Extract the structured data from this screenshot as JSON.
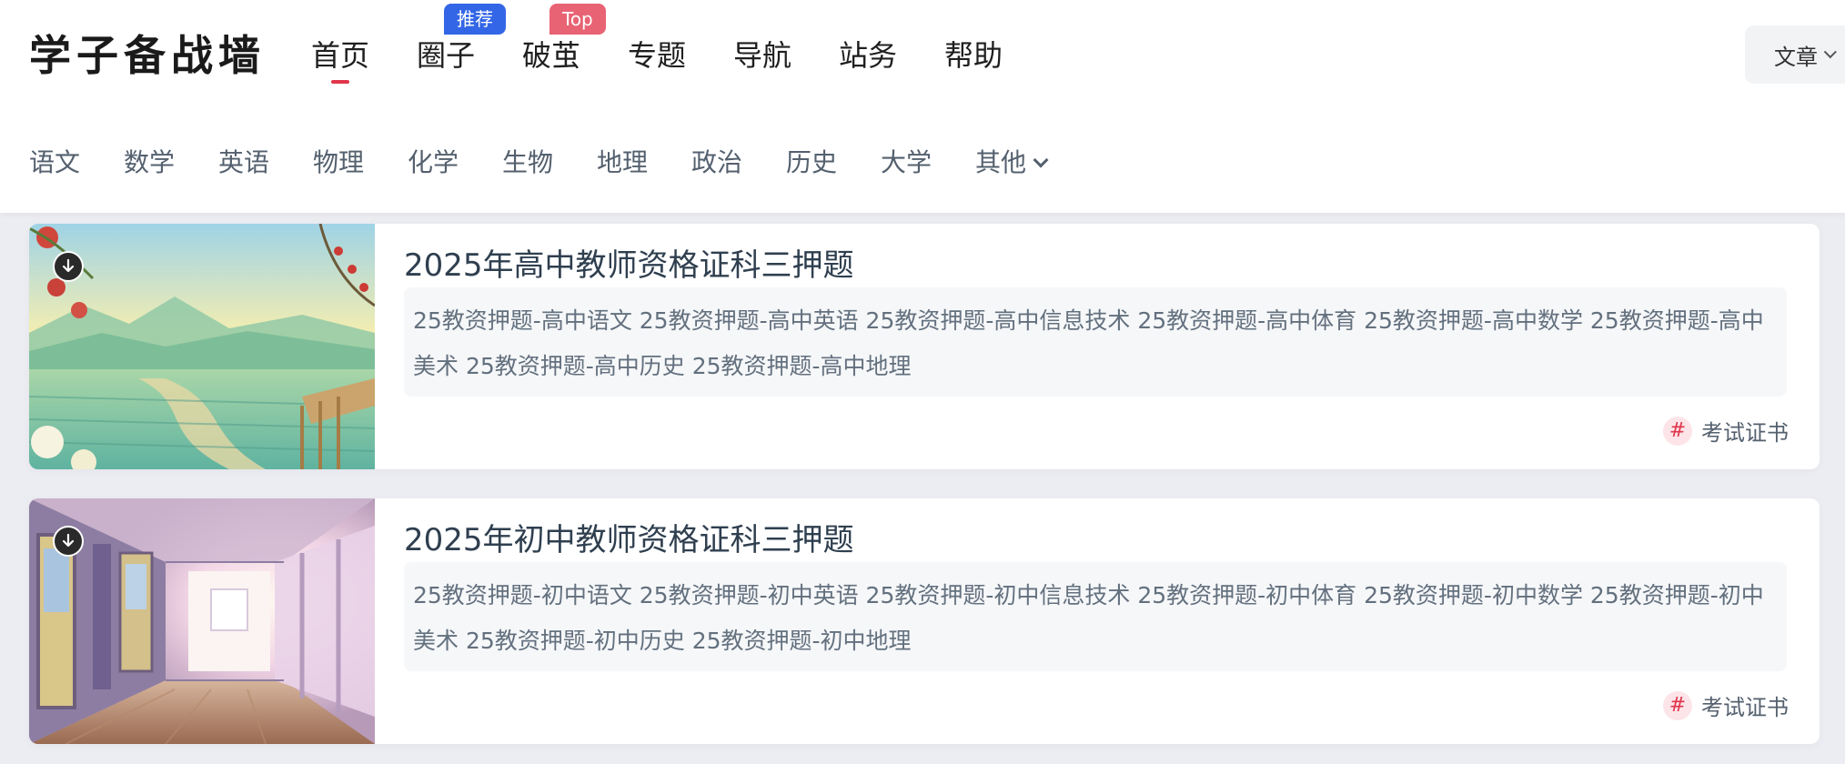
{
  "site": {
    "logo": "学子备战墙"
  },
  "main_nav": [
    {
      "label": "首页",
      "active": true
    },
    {
      "label": "圈子",
      "badge": "推荐",
      "badge_color": "#3366e6"
    },
    {
      "label": "破茧",
      "badge": "Top",
      "badge_color": "#e86374"
    },
    {
      "label": "专题"
    },
    {
      "label": "导航"
    },
    {
      "label": "站务"
    },
    {
      "label": "帮助"
    }
  ],
  "article_select": {
    "value": "文章"
  },
  "sub_nav": [
    "语文",
    "数学",
    "英语",
    "物理",
    "化学",
    "生物",
    "地理",
    "政治",
    "历史",
    "大学",
    "其他"
  ],
  "posts": [
    {
      "title": "2025年高中教师资格证科三押题",
      "desc": "25教资押题-高中语文 25教资押题-高中英语 25教资押题-高中信息技术 25教资押题-高中体育 25教资押题-高中数学 25教资押题-高中美术 25教资押题-高中历史 25教资押题-高中地理",
      "tag": "考试证书",
      "thumb_icon": "download-icon"
    },
    {
      "title": "2025年初中教师资格证科三押题",
      "desc": "25教资押题-初中语文 25教资押题-初中英语 25教资押题-初中信息技术 25教资押题-初中体育 25教资押题-初中数学 25教资押题-初中美术 25教资押题-初中历史 25教资押题-初中地理",
      "tag": "考试证书",
      "thumb_icon": "download-icon"
    }
  ],
  "colors": {
    "accent": "#e0354b",
    "badge_blue": "#3366e6",
    "badge_red": "#e86374"
  }
}
